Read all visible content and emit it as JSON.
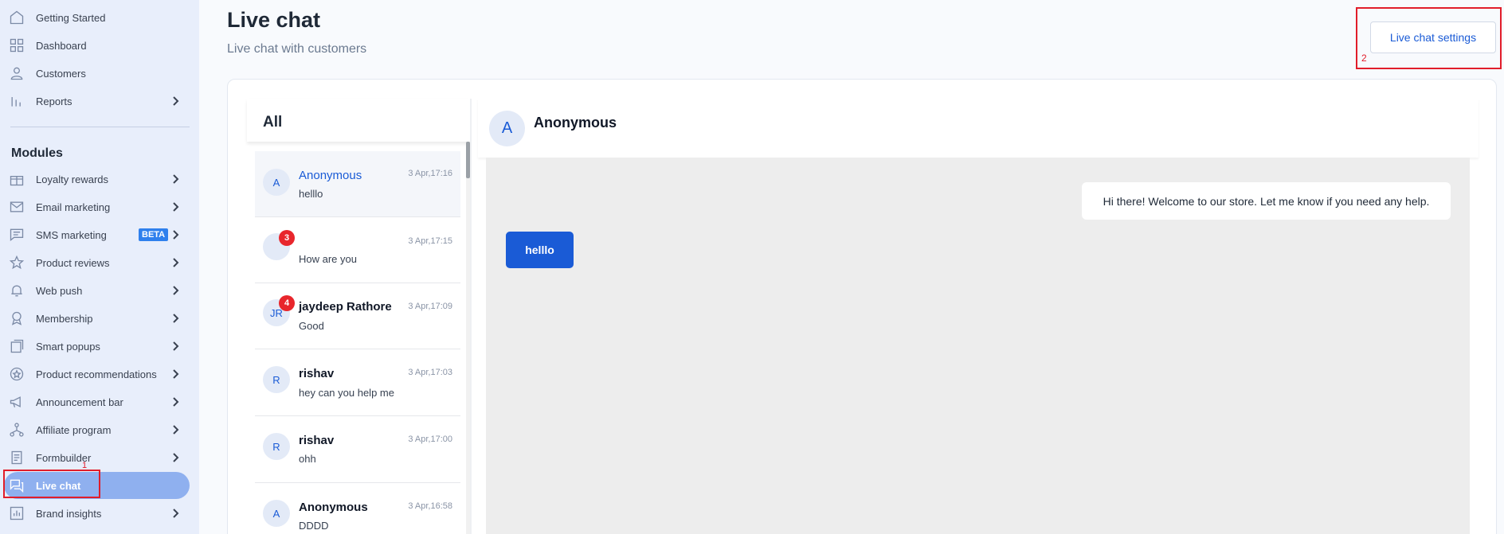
{
  "sidebar": {
    "top_items": [
      {
        "label": "Getting Started",
        "icon": "home-icon"
      },
      {
        "label": "Dashboard",
        "icon": "grid-icon"
      },
      {
        "label": "Customers",
        "icon": "user-icon"
      },
      {
        "label": "Reports",
        "icon": "bar-chart-icon"
      }
    ],
    "modules_title": "Modules",
    "module_items": [
      {
        "label": "Loyalty rewards",
        "icon": "gift-icon"
      },
      {
        "label": "Email marketing",
        "icon": "mail-icon"
      },
      {
        "label": "SMS marketing",
        "icon": "message-icon",
        "badge": "BETA"
      },
      {
        "label": "Product reviews",
        "icon": "star-icon"
      },
      {
        "label": "Web push",
        "icon": "bell-icon"
      },
      {
        "label": "Membership",
        "icon": "award-icon"
      },
      {
        "label": "Smart popups",
        "icon": "popup-icon"
      },
      {
        "label": "Product recommendations",
        "icon": "badge-star-icon"
      },
      {
        "label": "Announcement bar",
        "icon": "megaphone-icon"
      },
      {
        "label": "Affiliate program",
        "icon": "network-icon"
      },
      {
        "label": "Formbuilder",
        "icon": "form-icon"
      },
      {
        "label": "Live chat",
        "icon": "chat-icon"
      },
      {
        "label": "Brand insights",
        "icon": "insights-icon"
      }
    ],
    "annotation_1": "1"
  },
  "header": {
    "title": "Live chat",
    "subtitle": "Live chat with customers",
    "settings_button": "Live chat settings",
    "annotation_2": "2"
  },
  "conversation_list": {
    "filter_label": "All",
    "items": [
      {
        "avatar": "A",
        "name": "Anonymous",
        "message": "helllo",
        "time": "3 Apr,17:16",
        "badge": ""
      },
      {
        "avatar": "",
        "name": "",
        "message": "How are you",
        "time": "3 Apr,17:15",
        "badge": "3"
      },
      {
        "avatar": "JR",
        "name": "jaydeep Rathore",
        "message": "Good",
        "time": "3 Apr,17:09",
        "badge": "4"
      },
      {
        "avatar": "R",
        "name": "rishav",
        "message": "hey can you help me",
        "time": "3 Apr,17:03",
        "badge": ""
      },
      {
        "avatar": "R",
        "name": "rishav",
        "message": "ohh",
        "time": "3 Apr,17:00",
        "badge": ""
      },
      {
        "avatar": "A",
        "name": "Anonymous",
        "message": "DDDD",
        "time": "3 Apr,16:58",
        "badge": ""
      }
    ]
  },
  "chat": {
    "avatar": "A",
    "title": "Anonymous",
    "messages": [
      {
        "text": "Hi there! Welcome to our store. Let me know if you need any help."
      },
      {
        "text": "helllo"
      }
    ]
  },
  "colors": {
    "accent": "#1a5bd6",
    "sidebar_bg": "#e8eefb",
    "active_pill": "#8fb0ef",
    "badge_red": "#e8262c",
    "annotation_red": "#e11d2a"
  }
}
